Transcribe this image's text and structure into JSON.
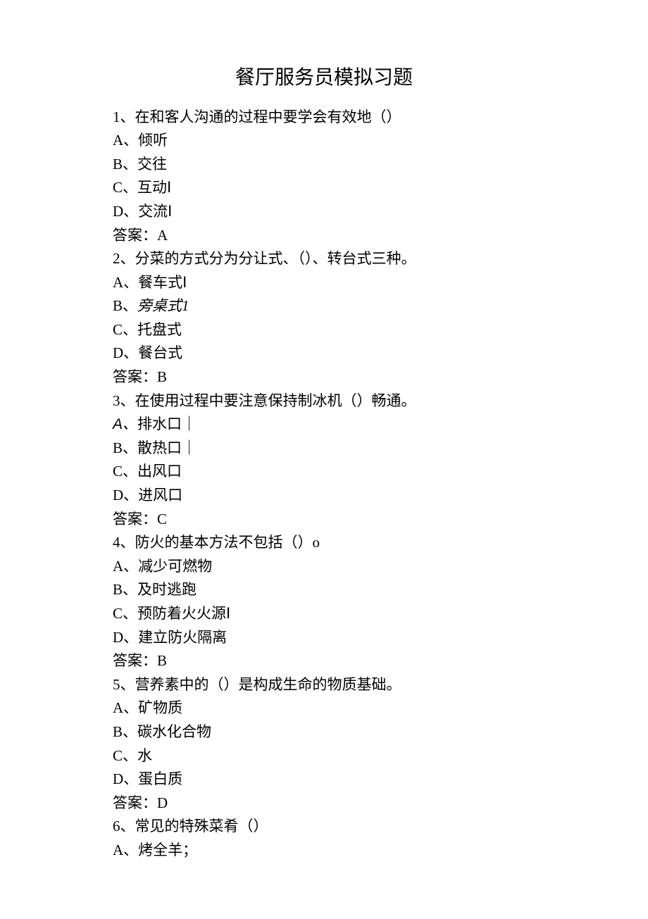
{
  "title": "餐厅服务员模拟习题",
  "questions": [
    {
      "num": "1、",
      "stem": "在和客人沟通的过程中要学会有效地（）",
      "options": [
        {
          "label": "A、",
          "text": "倾听"
        },
        {
          "label": "B、",
          "text": "交往"
        },
        {
          "label": "C、",
          "text": "互动Ⅰ"
        },
        {
          "label": "D、",
          "text": "交流Ⅰ"
        }
      ],
      "answer_label": "答案：",
      "answer": "A"
    },
    {
      "num": "2、",
      "stem": "分菜的方式分为分让式、（）、转台式三种。",
      "options": [
        {
          "label": "A、",
          "text": "餐车式Ⅰ"
        },
        {
          "label": "B、",
          "text": "旁桌式1",
          "italic": true
        },
        {
          "label": "C、",
          "text": "托盘式"
        },
        {
          "label": "D、",
          "text": "餐台式"
        }
      ],
      "answer_label": "答案：",
      "answer": "B"
    },
    {
      "num": "3、",
      "stem": "在使用过程中要注意保持制冰机（）畅通。",
      "options": [
        {
          "label": "A、",
          "text": "排水口｜",
          "sans_label": true
        },
        {
          "label": "B、",
          "text": "散热口｜"
        },
        {
          "label": "C、",
          "text": "出风口"
        },
        {
          "label": "D、",
          "text": "进风口"
        }
      ],
      "answer_label": "答案：",
      "answer": "C"
    },
    {
      "num": "4、",
      "stem": "防火的基本方法不包括（）o",
      "options": [
        {
          "label": "A、",
          "text": "减少可燃物"
        },
        {
          "label": "B、",
          "text": "及时逃跑"
        },
        {
          "label": "C、",
          "text": "预防着火火源Ⅰ"
        },
        {
          "label": "D、",
          "text": "建立防火隔离"
        }
      ],
      "answer_label": "答案：",
      "answer": "B"
    },
    {
      "num": "5、",
      "stem": "营养素中的（）是构成生命的物质基础。",
      "options": [
        {
          "label": "A、",
          "text": "矿物质"
        },
        {
          "label": "B、",
          "text": "碳水化合物"
        },
        {
          "label": "C、",
          "text": "水"
        },
        {
          "label": "D、",
          "text": "蛋白质"
        }
      ],
      "answer_label": "答案：",
      "answer": "D"
    },
    {
      "num": "6、",
      "stem": "常见的特殊菜肴（）",
      "options": [
        {
          "label": "A、",
          "text": "烤全羊；"
        }
      ]
    }
  ]
}
